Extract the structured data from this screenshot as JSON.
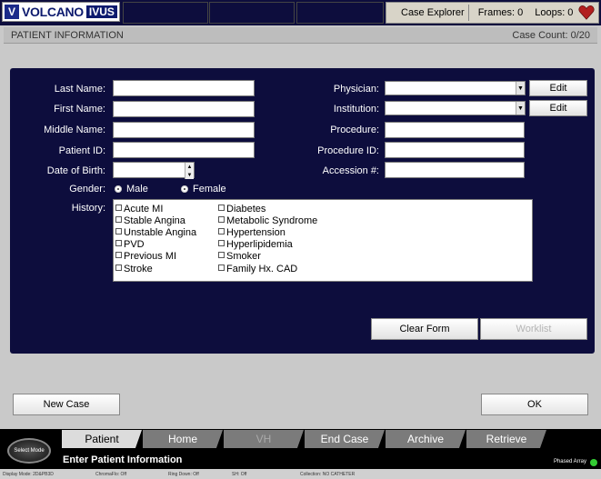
{
  "app": {
    "logo_text": "VOLCANO",
    "logo_badge": "IVUS",
    "case_explorer": "Case Explorer",
    "frames": "Frames: 0",
    "loops": "Loops: 0",
    "heart_icon": "heart-icon"
  },
  "infobar": {
    "title": "PATIENT INFORMATION",
    "case_count": "Case Count: 0/20"
  },
  "form": {
    "last_name_label": "Last Name:",
    "first_name_label": "First Name:",
    "middle_name_label": "Middle Name:",
    "patient_id_label": "Patient ID:",
    "dob_label": "Date of Birth:",
    "gender_label": "Gender:",
    "gender_male": "Male",
    "gender_female": "Female",
    "history_label": "History:",
    "physician_label": "Physician:",
    "institution_label": "Institution:",
    "procedure_label": "Procedure:",
    "procedure_id_label": "Procedure ID:",
    "accession_label": "Accession #:",
    "edit_label": "Edit",
    "clear_form": "Clear Form",
    "worklist": "Worklist",
    "values": {
      "last_name": "",
      "first_name": "",
      "middle_name": "",
      "patient_id": "",
      "dob": "",
      "physician": "",
      "institution": "",
      "procedure": "",
      "procedure_id": "",
      "accession": ""
    }
  },
  "history": {
    "col1": [
      "Acute MI",
      "Stable Angina",
      "Unstable Angina",
      "PVD",
      "Previous MI",
      "Stroke"
    ],
    "col2": [
      "Diabetes",
      "Metabolic Syndrome",
      "Hypertension",
      "Hyperlipidemia",
      "Smoker",
      "Family Hx. CAD"
    ]
  },
  "actions": {
    "new_case": "New Case",
    "ok": "OK"
  },
  "tabs": [
    {
      "label": "Patient",
      "state": "active"
    },
    {
      "label": "Home",
      "state": "normal"
    },
    {
      "label": "VH",
      "state": "disabled"
    },
    {
      "label": "End Case",
      "state": "normal"
    },
    {
      "label": "Archive",
      "state": "normal"
    },
    {
      "label": "Retrieve",
      "state": "normal"
    }
  ],
  "bottom": {
    "select_mode": "Select Mode",
    "enter_info": "Enter Patient Information",
    "phased_array": "Phased Array"
  },
  "statusbar": {
    "items": [
      "Display Mode: 2D&PB3D",
      "ChromaFlo: Off",
      "Ring Down: Off",
      "SH: Off",
      "Collection: NO CATHETER"
    ]
  },
  "colors": {
    "panel_bg": "#0d0d3d",
    "body_bg": "#c9c9c9",
    "phased_led": "#33cc33"
  }
}
